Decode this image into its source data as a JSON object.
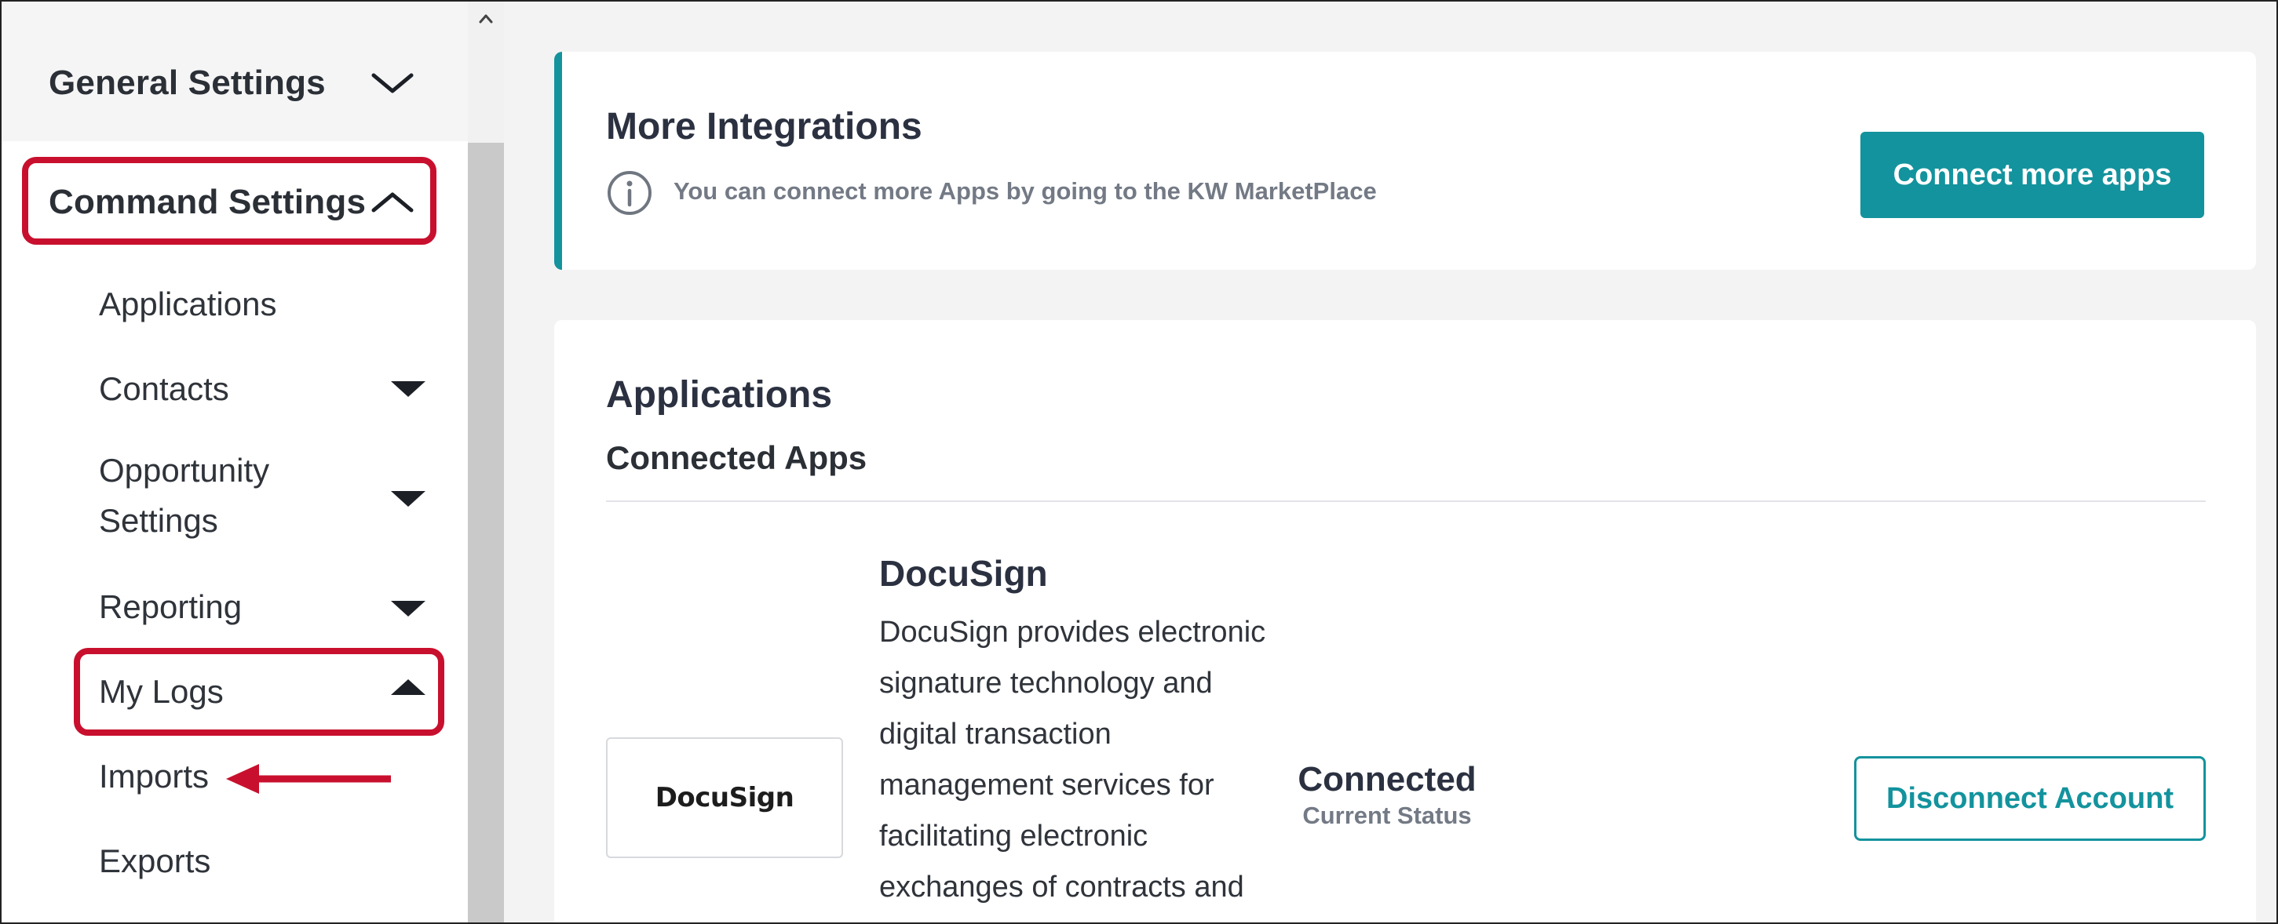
{
  "sidebar": {
    "sections": [
      {
        "label": "General Settings",
        "state": "collapsed"
      },
      {
        "label": "Command Settings",
        "state": "expanded"
      }
    ],
    "items": [
      {
        "label": "Applications",
        "toggle": "none"
      },
      {
        "label": "Contacts",
        "toggle": "down"
      },
      {
        "label": "Opportunity Settings",
        "toggle": "down"
      },
      {
        "label": "Reporting",
        "toggle": "down"
      },
      {
        "label": "My Logs",
        "toggle": "up"
      },
      {
        "label": "Imports",
        "toggle": "none"
      },
      {
        "label": "Exports",
        "toggle": "none"
      }
    ],
    "opportunity_lines": [
      "Opportunity",
      "Settings"
    ]
  },
  "integrations": {
    "title": "More Integrations",
    "info_text": "You can connect more Apps by going to the KW MarketPlace",
    "button_label": "Connect more apps",
    "info_icon": "info-icon"
  },
  "applications": {
    "title": "Applications",
    "subtitle": "Connected Apps",
    "apps": [
      {
        "name": "DocuSign",
        "logo_text": "DocuSign",
        "description_lines": [
          "DocuSign provides electronic",
          "signature technology and",
          "digital transaction",
          "management services for",
          "facilitating electronic",
          "exchanges of contracts and"
        ],
        "status": "Connected",
        "status_caption": "Current Status",
        "action_label": "Disconnect Account"
      }
    ]
  },
  "colors": {
    "accent": "#13939d",
    "highlight": "#c8102e",
    "text": "#2b2f36"
  }
}
